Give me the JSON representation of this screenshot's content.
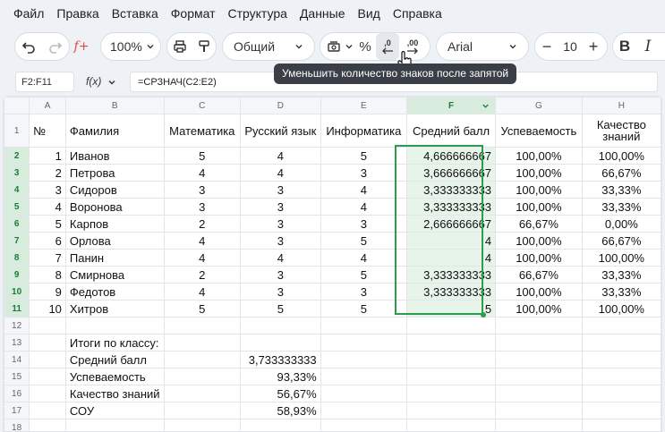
{
  "menu": [
    "Файл",
    "Правка",
    "Вставка",
    "Формат",
    "Структура",
    "Данные",
    "Вид",
    "Справка"
  ],
  "toolbar": {
    "zoom": "100%",
    "format": "Общий",
    "percent": "%",
    "decrease_decimals": ",0",
    "increase_decimals": ",00",
    "font": "Arial",
    "font_size": "10",
    "minus": "−",
    "plus": "+",
    "bold": "B",
    "italic": "I"
  },
  "tooltip": "Уменьшить количество знаков после запятой",
  "formula_bar": {
    "name_box": "F2:F11",
    "fx": "f(x)",
    "formula": "=СРЗНАЧ(C2:E2)"
  },
  "columns": [
    "A",
    "B",
    "C",
    "D",
    "E",
    "F",
    "G",
    "H"
  ],
  "header_row": [
    "№",
    "Фамилия",
    "Математика",
    "Русский язык",
    "Информатика",
    "Средний балл",
    "Успеваемость",
    "Качество знаний"
  ],
  "rows": [
    [
      "1",
      "Иванов",
      "5",
      "4",
      "5",
      "4,666666667",
      "100,00%",
      "100,00%"
    ],
    [
      "2",
      "Петрова",
      "4",
      "4",
      "3",
      "3,666666667",
      "100,00%",
      "66,67%"
    ],
    [
      "3",
      "Сидоров",
      "3",
      "3",
      "4",
      "3,333333333",
      "100,00%",
      "33,33%"
    ],
    [
      "4",
      "Воронова",
      "3",
      "3",
      "4",
      "3,333333333",
      "100,00%",
      "33,33%"
    ],
    [
      "5",
      "Карпов",
      "2",
      "3",
      "3",
      "2,666666667",
      "66,67%",
      "0,00%"
    ],
    [
      "6",
      "Орлова",
      "4",
      "3",
      "5",
      "4",
      "100,00%",
      "66,67%"
    ],
    [
      "7",
      "Панин",
      "4",
      "4",
      "4",
      "4",
      "100,00%",
      "100,00%"
    ],
    [
      "8",
      "Смирнова",
      "2",
      "3",
      "5",
      "3,333333333",
      "66,67%",
      "33,33%"
    ],
    [
      "9",
      "Федотов",
      "4",
      "3",
      "3",
      "3,333333333",
      "100,00%",
      "33,33%"
    ],
    [
      "10",
      "Хитров",
      "5",
      "5",
      "5",
      "5",
      "100,00%",
      "100,00%"
    ]
  ],
  "row_numbers": [
    "1",
    "2",
    "3",
    "4",
    "5",
    "6",
    "7",
    "8",
    "9",
    "10",
    "11",
    "12",
    "13",
    "14",
    "15",
    "16",
    "17",
    "18"
  ],
  "summary": {
    "title": "Итоги по классу:",
    "items": [
      {
        "label": "Средний балл",
        "value": "3,733333333"
      },
      {
        "label": "Успеваемость",
        "value": "93,33%"
      },
      {
        "label": "Качество знаний",
        "value": "56,67%"
      },
      {
        "label": "СОУ",
        "value": "58,93%"
      }
    ]
  },
  "colors": {
    "selection": "#2e9c4f",
    "selection_fill": "#e6f4ea",
    "tooltip_bg": "#3a3f47"
  }
}
